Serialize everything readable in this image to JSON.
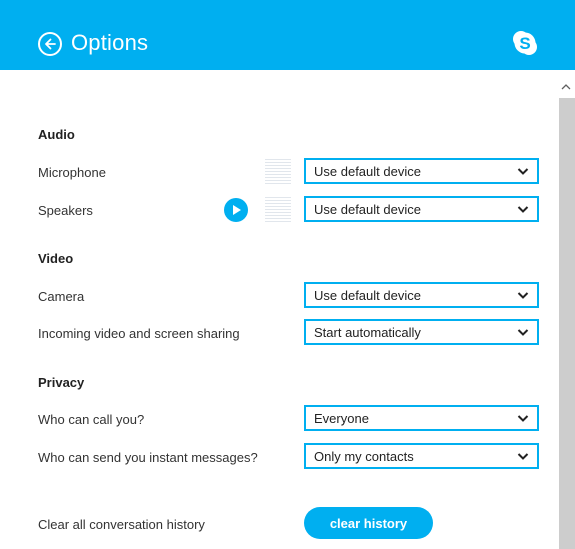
{
  "header": {
    "title": "Options",
    "back_icon": "back-arrow-icon",
    "logo_icon": "skype-logo-icon",
    "background": "#00aff0"
  },
  "audio": {
    "title": "Audio",
    "microphone": {
      "label": "Microphone",
      "value": "Use default device"
    },
    "speakers": {
      "label": "Speakers",
      "value": "Use default device",
      "play_icon": "play-icon"
    }
  },
  "video": {
    "title": "Video",
    "camera": {
      "label": "Camera",
      "value": "Use default device"
    },
    "incoming": {
      "label": "Incoming video and screen sharing",
      "value": "Start automatically"
    }
  },
  "privacy": {
    "title": "Privacy",
    "who_can_call": {
      "label": "Who can call you?",
      "value": "Everyone"
    },
    "who_can_message": {
      "label": "Who can send you instant messages?",
      "value": "Only my contacts"
    }
  },
  "history": {
    "label": "Clear all conversation history",
    "button_label": "clear history"
  },
  "colors": {
    "accent": "#00aff0",
    "scroll_thumb": "#cdcdcd"
  }
}
